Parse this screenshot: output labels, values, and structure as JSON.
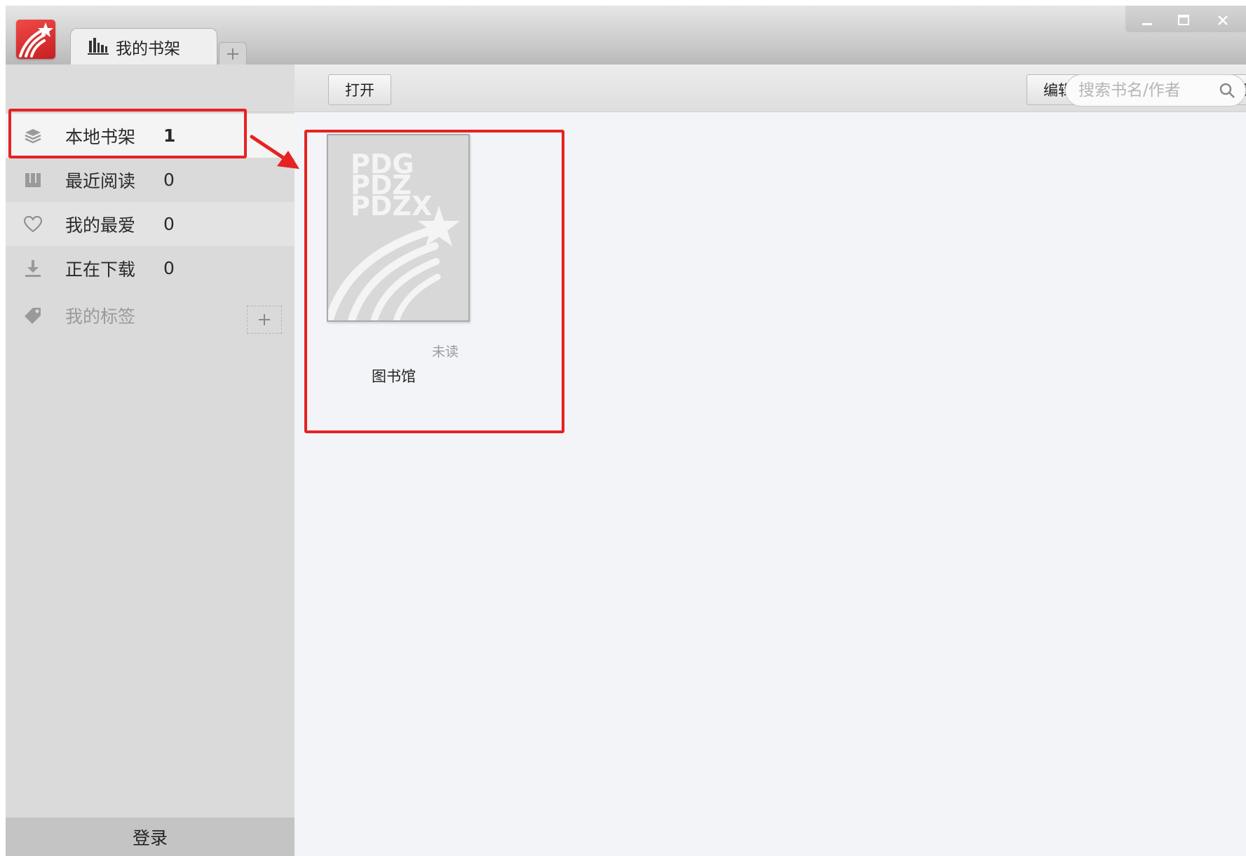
{
  "window": {
    "tab_label": "我的书架"
  },
  "sidebar": {
    "items": [
      {
        "label": "本地书架",
        "count": "1"
      },
      {
        "label": "最近阅读",
        "count": "0"
      },
      {
        "label": "我的最爱",
        "count": "0"
      },
      {
        "label": "正在下载",
        "count": "0"
      },
      {
        "label": "我的标签"
      }
    ],
    "login_label": "登录"
  },
  "toolbar": {
    "open_label": "打开",
    "edit_label": "编辑",
    "search_placeholder": "搜索书名/作者"
  },
  "book": {
    "cover_lines": [
      "PDG",
      "PDZ",
      "PDZX"
    ],
    "status": "未读",
    "title": "图书馆"
  },
  "icons": {
    "logo": "app-logo-icon",
    "tab": "bookshelf-icon",
    "local": "layers-icon",
    "recent": "book-icon",
    "favorites": "heart-icon",
    "downloading": "download-icon",
    "tags": "tag-icon",
    "search": "search-icon"
  },
  "colors": {
    "highlight": "#e62222",
    "logo": "#d62b2b"
  }
}
